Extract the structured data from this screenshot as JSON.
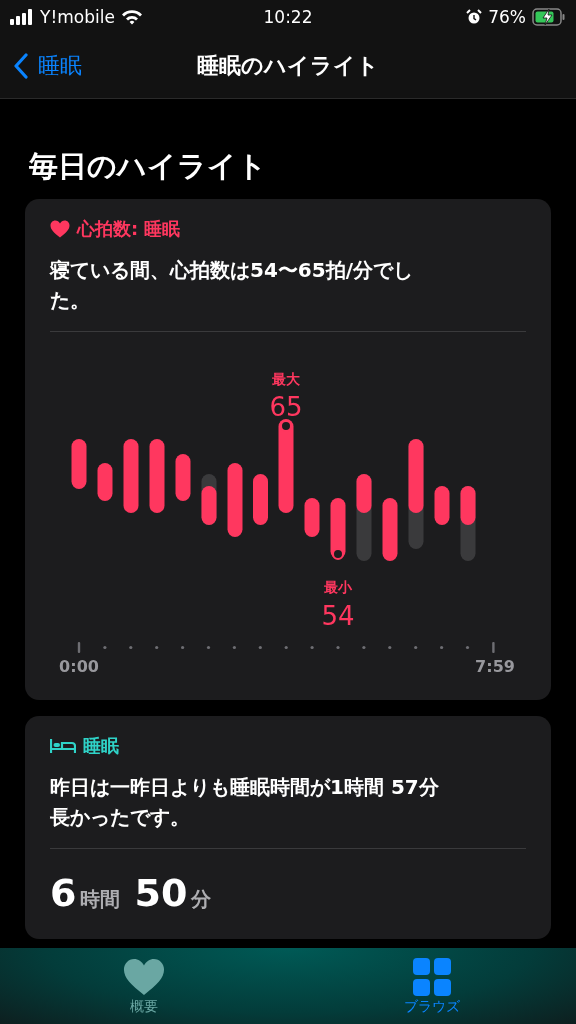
{
  "status_bar": {
    "carrier": "Y!mobile",
    "time": "10:22",
    "battery": "76%"
  },
  "nav": {
    "back": "睡眠",
    "title": "睡眠のハイライト"
  },
  "section_title": "毎日のハイライト",
  "cards": [
    {
      "kind": "heart_rate",
      "title": "心拍数: 睡眠",
      "summary": "寝ている間、心拍数は54〜65拍/分でした。",
      "chart": {
        "max_label": "最大",
        "max_value": "65",
        "min_label": "最小",
        "min_value": "54",
        "x_start": "0:00",
        "x_end": "7:59"
      }
    },
    {
      "kind": "sleep",
      "title": "睡眠",
      "summary": "昨日は一昨日よりも睡眠時間が1時間 57分長かったです。",
      "duration": [
        {
          "number": "6",
          "unit": "時間"
        },
        {
          "number": "50",
          "unit": "分"
        }
      ]
    }
  ],
  "tabs": [
    {
      "label": "概要",
      "selected": false
    },
    {
      "label": "ブラウズ",
      "selected": true
    }
  ]
}
